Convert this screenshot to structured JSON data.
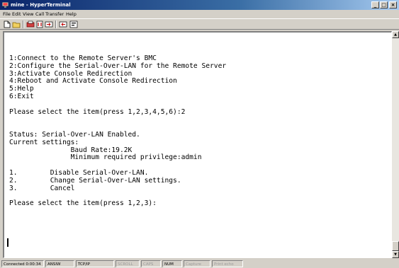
{
  "window": {
    "title": "mine - HyperTerminal",
    "minimize_glyph": "_",
    "maximize_glyph": "□",
    "close_glyph": "×"
  },
  "menu": {
    "items": [
      "File",
      "Edit",
      "View",
      "Call",
      "Transfer",
      "Help"
    ]
  },
  "toolbar": {
    "buttons": [
      "new-icon",
      "open-icon",
      "call-icon",
      "disconnect-icon",
      "send-icon",
      "receive-icon",
      "properties-icon"
    ]
  },
  "terminal": {
    "lines": [
      "1:Connect to the Remote Server's BMC",
      "2:Configure the Serial-Over-LAN for the Remote Server",
      "3:Activate Console Redirection",
      "4:Reboot and Activate Console Redirection",
      "5:Help",
      "6:Exit",
      "",
      "Please select the item(press 1,2,3,4,5,6):2",
      "",
      "",
      "Status: Serial-Over-LAN Enabled.",
      "Current settings:",
      "               Baud Rate:19.2K",
      "               Minimum required privilege:admin",
      "",
      "1.        Disable Serial-Over-LAN.",
      "2.        Change Serial-Over-LAN settings.",
      "3.        Cancel",
      "",
      "Please select the item(press 1,2,3):"
    ]
  },
  "scrollbar": {
    "up_glyph": "▲",
    "down_glyph": "▼"
  },
  "status": {
    "connected": "Connected 0:00:34",
    "emulation": "ANSIW",
    "protocol": "TCP/IP",
    "scroll": "SCROLL",
    "caps": "CAPS",
    "num": "NUM",
    "capture": "Capture",
    "print_echo": "Print echo"
  },
  "colors": {
    "titlebar_start": "#0a246a",
    "titlebar_end": "#a6caf0",
    "chrome": "#d4d0c8",
    "terminal_bg": "#ffffff"
  }
}
